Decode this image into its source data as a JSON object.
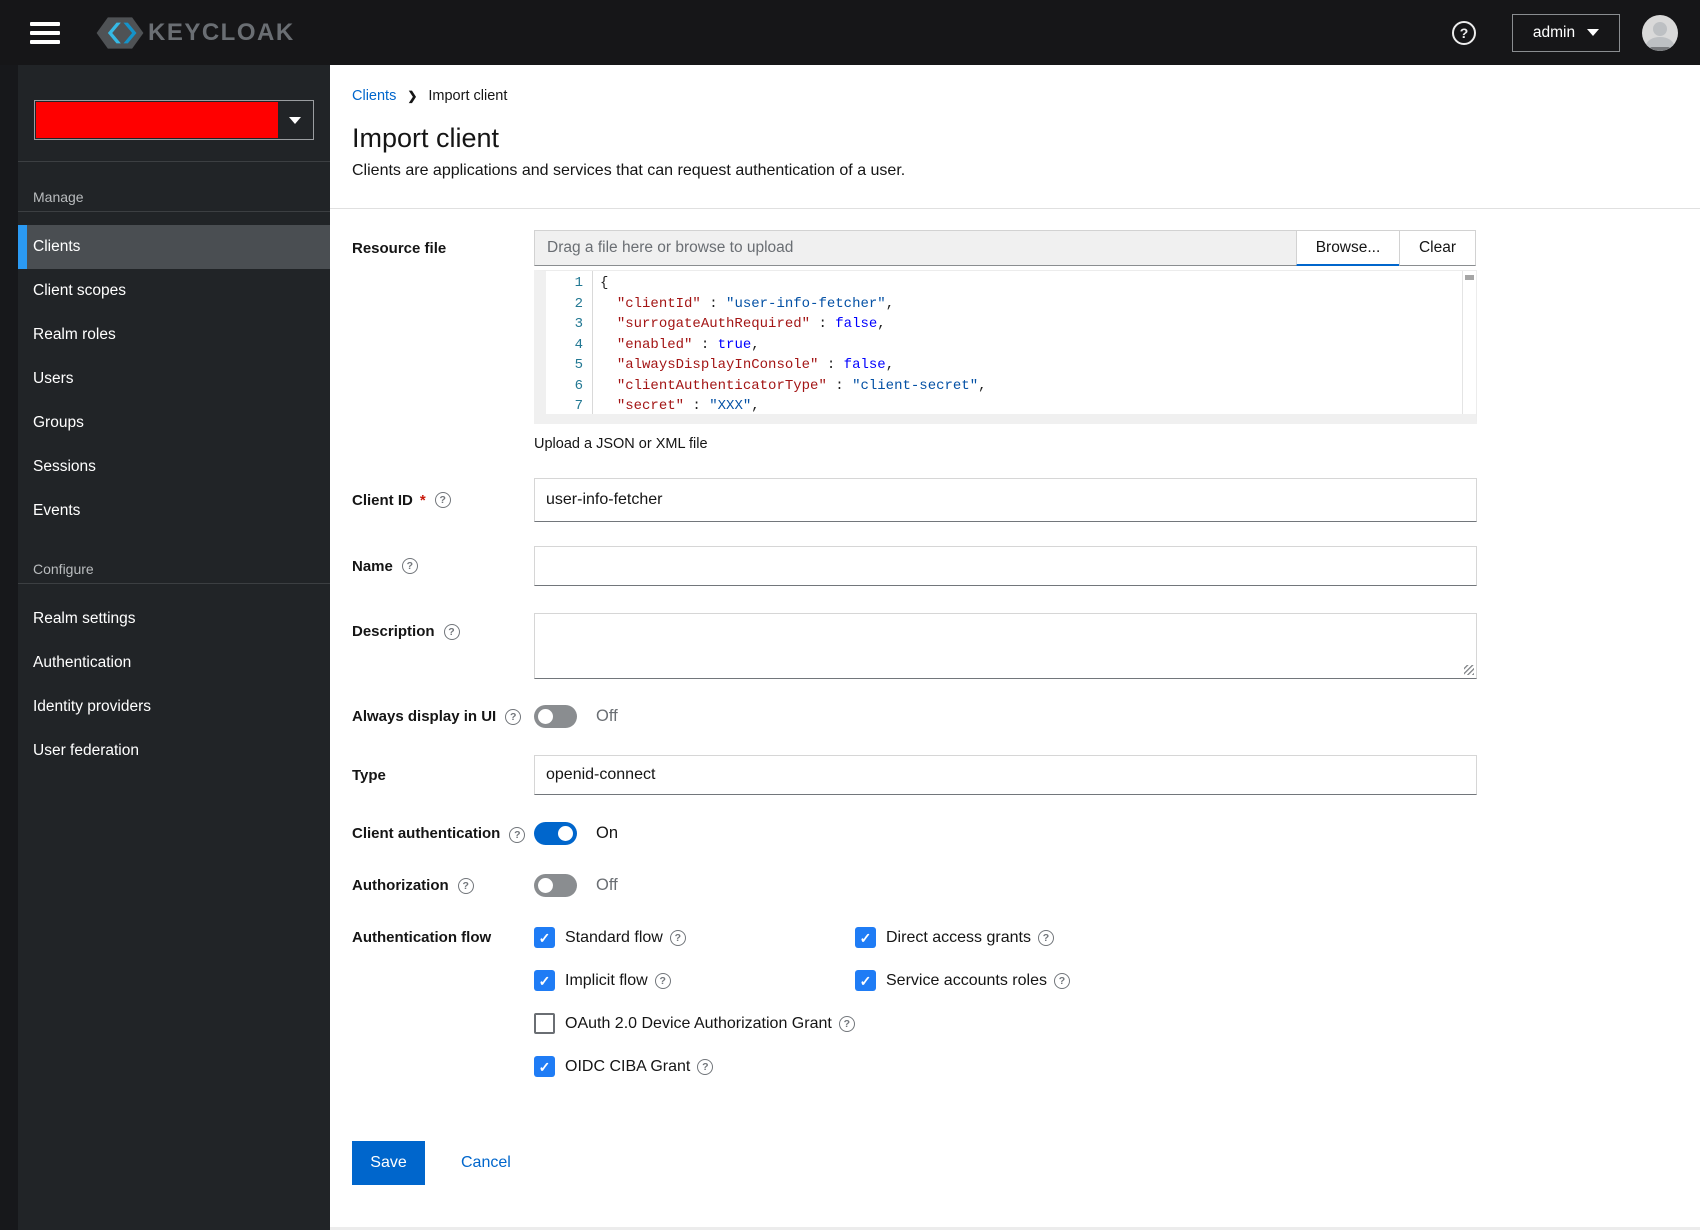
{
  "masthead": {
    "brand": "KEYCLOAK",
    "help_icon": "question-circle-icon",
    "user_menu": {
      "label": "admin"
    }
  },
  "sidebar": {
    "realm_selector": {
      "redacted": true,
      "redaction_color": "#ff0000"
    },
    "sections": [
      {
        "title": "Manage",
        "items": [
          {
            "label": "Clients",
            "current": true
          },
          {
            "label": "Client scopes",
            "current": false
          },
          {
            "label": "Realm roles",
            "current": false
          },
          {
            "label": "Users",
            "current": false
          },
          {
            "label": "Groups",
            "current": false
          },
          {
            "label": "Sessions",
            "current": false
          },
          {
            "label": "Events",
            "current": false
          }
        ]
      },
      {
        "title": "Configure",
        "items": [
          {
            "label": "Realm settings",
            "current": false
          },
          {
            "label": "Authentication",
            "current": false
          },
          {
            "label": "Identity providers",
            "current": false
          },
          {
            "label": "User federation",
            "current": false
          }
        ]
      }
    ]
  },
  "breadcrumb": {
    "items": [
      {
        "label": "Clients",
        "link": true
      },
      {
        "label": "Import client",
        "link": false
      }
    ]
  },
  "page": {
    "title": "Import client",
    "subtitle": "Clients are applications and services that can request authentication of a user."
  },
  "form": {
    "resource_file": {
      "label": "Resource file",
      "placeholder": "Drag a file here or browse to upload",
      "browse_label": "Browse...",
      "clear_label": "Clear",
      "helper": "Upload a JSON or XML file",
      "code": {
        "lines": [
          [
            [
              "punc",
              "{"
            ]
          ],
          [
            [
              "plain",
              "  "
            ],
            [
              "key",
              "\"clientId\""
            ],
            [
              "plain",
              " : "
            ],
            [
              "str",
              "\"user-info-fetcher\""
            ],
            [
              "plain",
              ","
            ]
          ],
          [
            [
              "plain",
              "  "
            ],
            [
              "key",
              "\"surrogateAuthRequired\""
            ],
            [
              "plain",
              " : "
            ],
            [
              "kw",
              "false"
            ],
            [
              "plain",
              ","
            ]
          ],
          [
            [
              "plain",
              "  "
            ],
            [
              "key",
              "\"enabled\""
            ],
            [
              "plain",
              " : "
            ],
            [
              "kw",
              "true"
            ],
            [
              "plain",
              ","
            ]
          ],
          [
            [
              "plain",
              "  "
            ],
            [
              "key",
              "\"alwaysDisplayInConsole\""
            ],
            [
              "plain",
              " : "
            ],
            [
              "kw",
              "false"
            ],
            [
              "plain",
              ","
            ]
          ],
          [
            [
              "plain",
              "  "
            ],
            [
              "key",
              "\"clientAuthenticatorType\""
            ],
            [
              "plain",
              " : "
            ],
            [
              "str",
              "\"client-secret\""
            ],
            [
              "plain",
              ","
            ]
          ],
          [
            [
              "plain",
              "  "
            ],
            [
              "key",
              "\"secret\""
            ],
            [
              "plain",
              " : "
            ],
            [
              "str",
              "\"XXX\""
            ],
            [
              "plain",
              ","
            ]
          ]
        ]
      }
    },
    "client_id": {
      "label": "Client ID",
      "required_indicator": "*",
      "value": "user-info-fetcher"
    },
    "name": {
      "label": "Name",
      "value": ""
    },
    "description": {
      "label": "Description",
      "value": ""
    },
    "always_display": {
      "label": "Always display in UI",
      "state": "Off",
      "on": false
    },
    "type": {
      "label": "Type",
      "value": "openid-connect"
    },
    "client_auth": {
      "label": "Client authentication",
      "state": "On",
      "on": true
    },
    "authorization": {
      "label": "Authorization",
      "state": "Off",
      "on": false
    },
    "auth_flow": {
      "label": "Authentication flow",
      "options": [
        {
          "label": "Standard flow",
          "checked": true
        },
        {
          "label": "Direct access grants",
          "checked": true
        },
        {
          "label": "Implicit flow",
          "checked": true
        },
        {
          "label": "Service accounts roles",
          "checked": true
        },
        {
          "label": "OAuth 2.0 Device Authorization Grant",
          "checked": false
        },
        {
          "label": "OIDC CIBA Grant",
          "checked": true
        }
      ]
    },
    "actions": {
      "save": "Save",
      "cancel": "Cancel"
    }
  },
  "colors": {
    "accent": "#0066cc",
    "checkbox": "#1f7cf5",
    "masthead": "#161618",
    "sidebar": "#212427",
    "nav_selected": "#4a4e52",
    "nav_accent": "#2b9af3",
    "redaction": "#ff0000",
    "code_key": "#a31515",
    "code_string": "#0451a5",
    "code_keyword": "#0000ff",
    "code_line_number": "#237893"
  }
}
